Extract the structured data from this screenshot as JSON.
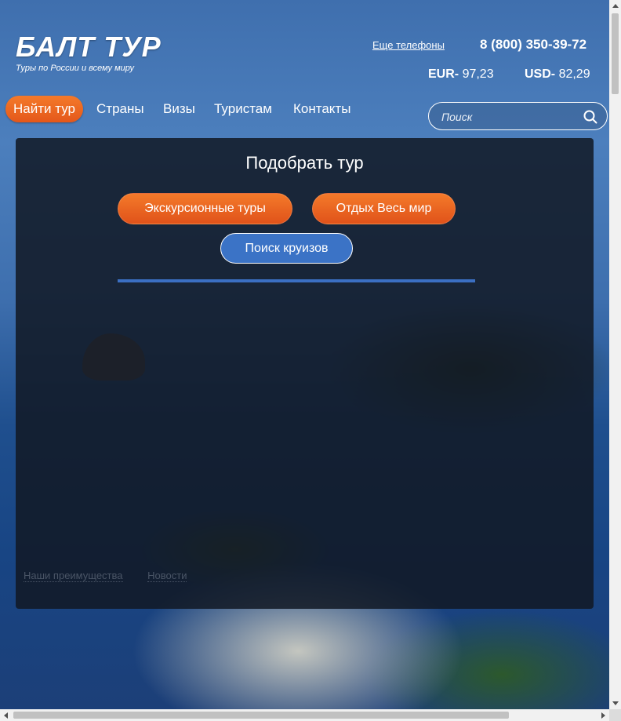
{
  "header": {
    "logo": "БАЛТ ТУР",
    "tagline": "Туры по России и всему миру",
    "more_phones": "Еще телефоны",
    "phone": "8 (800) 350-39-72",
    "rates": {
      "eur_label": "EUR-",
      "eur_value": "97,23",
      "usd_label": "USD-",
      "usd_value": "82,29"
    }
  },
  "nav": {
    "items": [
      {
        "label": "Найти тур",
        "active": true
      },
      {
        "label": "Страны"
      },
      {
        "label": "Визы"
      },
      {
        "label": "Туристам"
      },
      {
        "label": "Контакты"
      }
    ]
  },
  "search": {
    "placeholder": "Поиск",
    "icon": "search-icon"
  },
  "panel": {
    "title": "Подобрать тур",
    "buttons": {
      "excursion": "Экскурсионные туры",
      "rest": "Отдых Весь мир",
      "cruise": "Поиск круизов"
    },
    "links": [
      "Наши преимущества",
      "Новости"
    ]
  },
  "colors": {
    "accent_orange": "#f06a22",
    "accent_blue": "#3b73c6",
    "panel_bg": "#121824"
  }
}
